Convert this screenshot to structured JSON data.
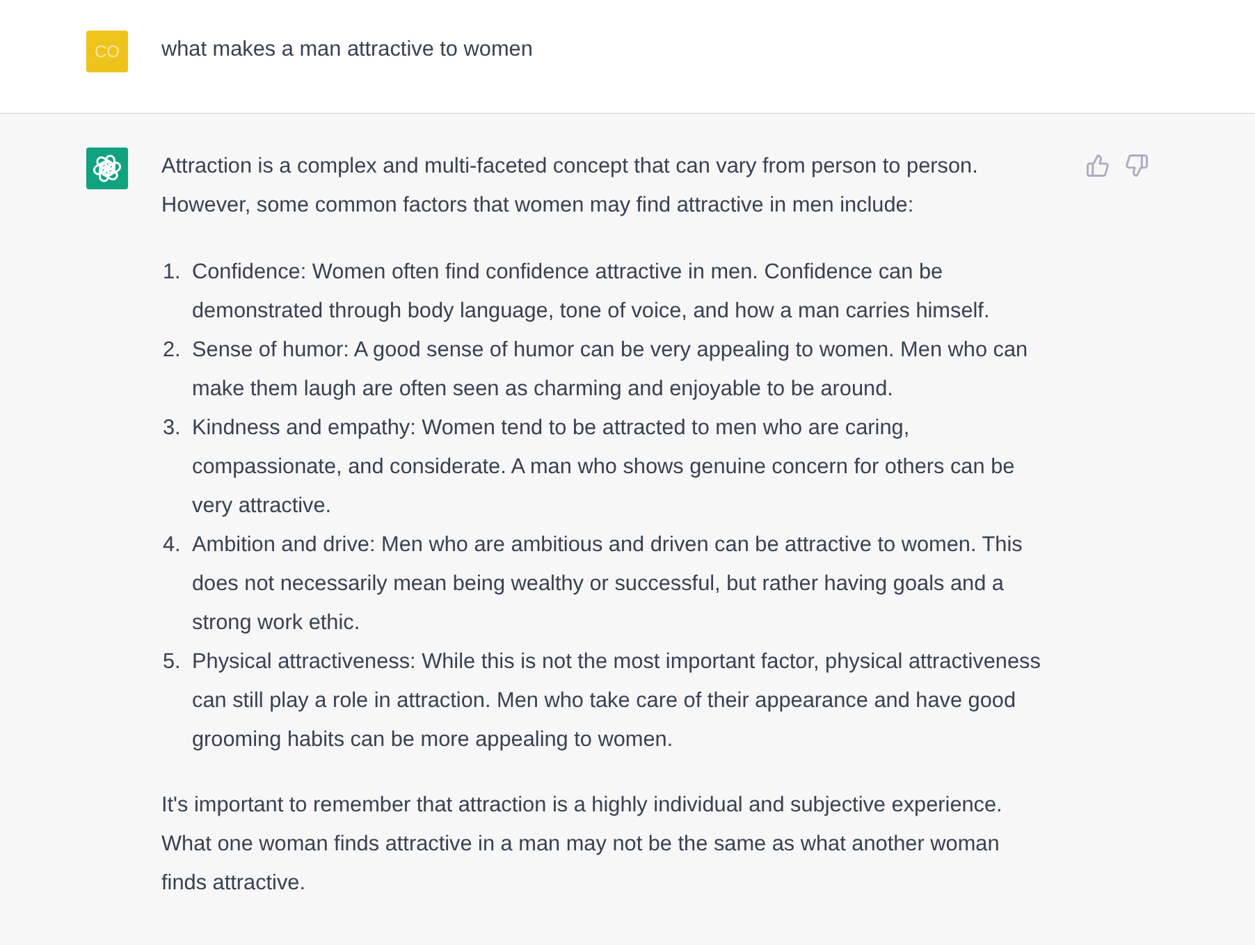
{
  "user_message": {
    "avatar": "CO",
    "text": "what makes a man attractive to women"
  },
  "assistant_message": {
    "intro": "Attraction is a complex and multi-faceted concept that can vary from person to person. However, some common factors that women may find attractive in men include:",
    "list": [
      {
        "number": "1.",
        "text": "Confidence: Women often find confidence attractive in men. Confidence can be demonstrated through body language, tone of voice, and how a man carries himself."
      },
      {
        "number": "2.",
        "text": "Sense of humor: A good sense of humor can be very appealing to women. Men who can make them laugh are often seen as charming and enjoyable to be around."
      },
      {
        "number": "3.",
        "text": "Kindness and empathy: Women tend to be attracted to men who are caring, compassionate, and considerate. A man who shows genuine concern for others can be very attractive."
      },
      {
        "number": "4.",
        "text": "Ambition and drive: Men who are ambitious and driven can be attractive to women. This does not necessarily mean being wealthy or successful, but rather having goals and a strong work ethic."
      },
      {
        "number": "5.",
        "text": "Physical attractiveness: While this is not the most important factor, physical attractiveness can still play a role in attraction. Men who take care of their appearance and have good grooming habits can be more appealing to women."
      }
    ],
    "closing": "It's important to remember that attraction is a highly individual and subjective experience. What one woman finds attractive in a man may not be the same as what another woman finds attractive."
  }
}
